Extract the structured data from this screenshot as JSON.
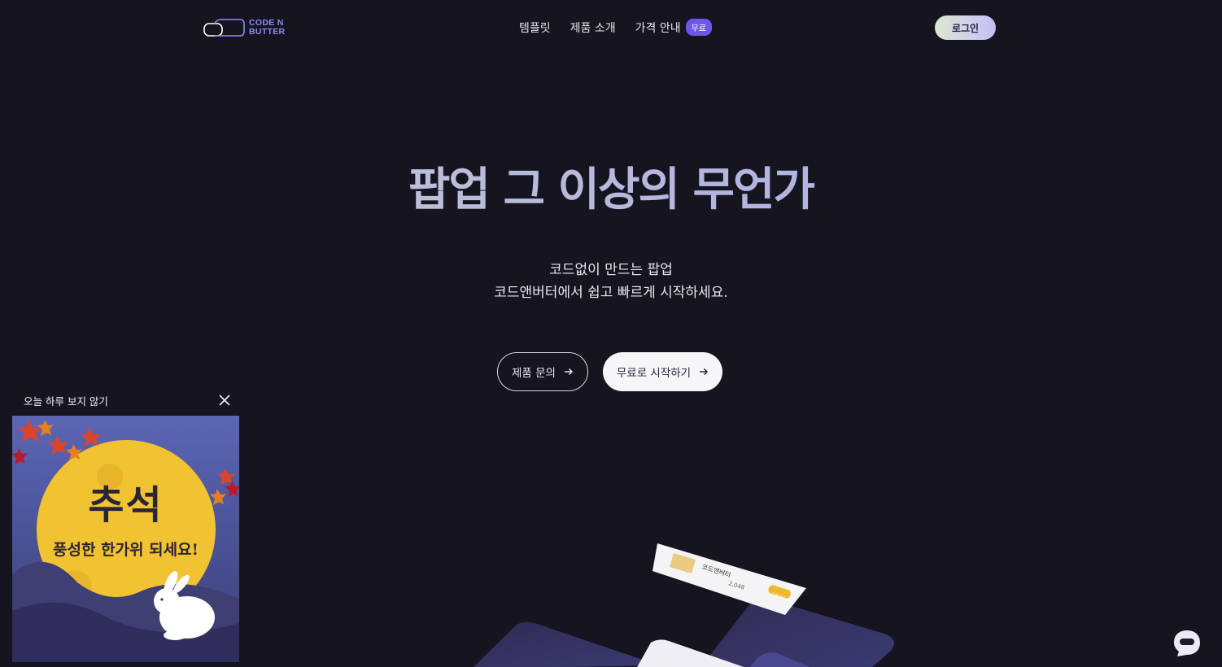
{
  "header": {
    "logo_text_line1": "CODE N",
    "logo_text_line2": "BUTTER",
    "nav": [
      {
        "label": "템플릿"
      },
      {
        "label": "제품 소개"
      },
      {
        "label": "가격 안내",
        "badge": "무료"
      }
    ],
    "login_label": "로그인"
  },
  "hero": {
    "title": "팝업 그 이상의 무언가",
    "subtitle_line1": "코드없이 만드는 팝업",
    "subtitle_line2": "코드앤버터에서 쉽고 빠르게 시작하세요.",
    "cta_inquiry": "제품 문의",
    "cta_start": "무료로 시작하기"
  },
  "illustration": {
    "card_name": "코드앤버터",
    "card_count": "2,048",
    "card_button": "다운로드"
  },
  "popup": {
    "dismiss_label": "오늘 하루 보지 않기",
    "banner_title": "추석",
    "banner_subtitle": "풍성한 한가위 되세요!"
  },
  "colors": {
    "background": "#16141f",
    "accent": "#6e56f0",
    "logo": "#8f8df5",
    "moon": "#f1c232"
  }
}
